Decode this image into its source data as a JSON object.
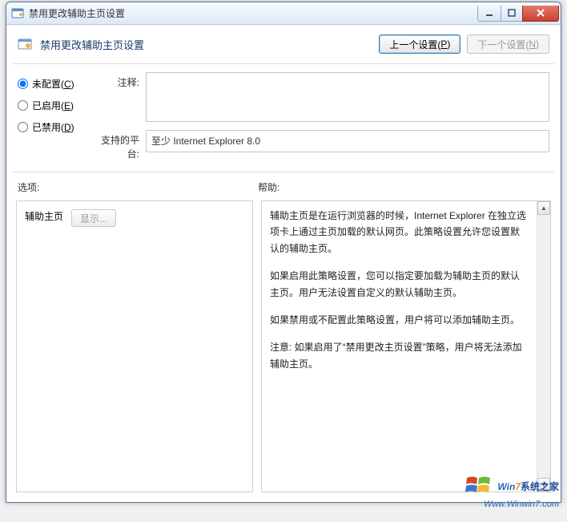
{
  "window": {
    "title": "禁用更改辅助主页设置"
  },
  "header": {
    "title": "禁用更改辅助主页设置",
    "prev_button": "上一个设置(",
    "prev_key": "P",
    "prev_suffix": ")",
    "next_button": "下一个设置(",
    "next_key": "N",
    "next_suffix": ")"
  },
  "radio": {
    "not_configured": "未配置(",
    "not_configured_key": "C",
    "enabled": "已启用(",
    "enabled_key": "E",
    "disabled": "已禁用(",
    "disabled_key": "D",
    "suffix": ")",
    "selected": "not_configured"
  },
  "labels": {
    "comment": "注释:",
    "platform": "支持的平台:",
    "options": "选项:",
    "help": "帮助:"
  },
  "platform_value": "至少 Internet Explorer 8.0",
  "options": {
    "secondary_home": "辅助主页",
    "show_button": "显示..."
  },
  "help": {
    "p1": "辅助主页是在运行浏览器的时候，Internet Explorer 在独立选项卡上通过主页加载的默认网页。此策略设置允许您设置默认的辅助主页。",
    "p2": "如果启用此策略设置，您可以指定要加载为辅助主页的默认主页。用户无法设置自定义的默认辅助主页。",
    "p3": "如果禁用或不配置此策略设置，用户将可以添加辅助主页。",
    "p4": "注意: 如果启用了“禁用更改主页设置”策略，用户将无法添加辅助主页。"
  },
  "watermark": {
    "brand_prefix": "W",
    "brand_mid": "in",
    "brand_num": "7",
    "brand_suffix": "系统之家",
    "url": "Www.Winwin7.com"
  }
}
